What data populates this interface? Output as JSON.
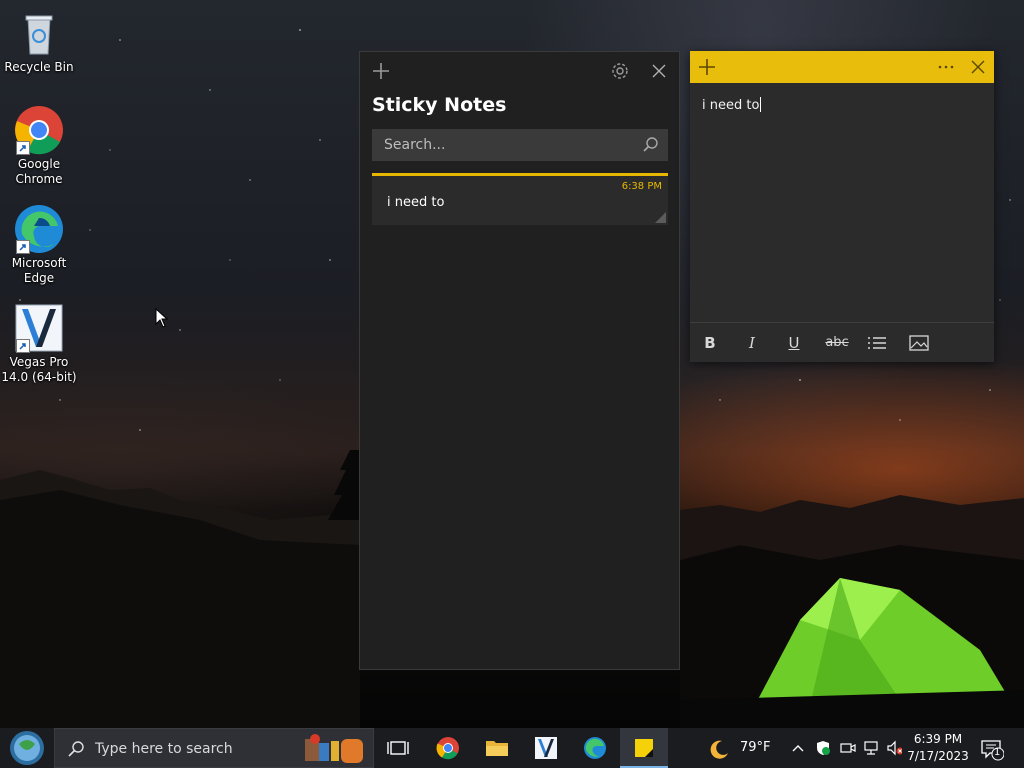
{
  "desktop": {
    "icons": [
      {
        "label": "Recycle Bin",
        "icon": "recycle-bin-icon"
      },
      {
        "label": "Google Chrome",
        "icon": "chrome-icon"
      },
      {
        "label": "Microsoft Edge",
        "icon": "edge-icon"
      },
      {
        "label": "Vegas Pro 14.0 (64-bit)",
        "icon": "vegas-pro-icon"
      }
    ]
  },
  "sticky_list": {
    "title": "Sticky Notes",
    "search_placeholder": "Search...",
    "notes": [
      {
        "time": "6:38 PM",
        "text": "i need to"
      }
    ]
  },
  "sticky_note": {
    "body": "i need to",
    "header_color": "#e8bd0b",
    "toolbar": [
      {
        "label": "B",
        "icon": "bold-icon"
      },
      {
        "label": "I",
        "icon": "italic-icon"
      },
      {
        "label": "U",
        "icon": "underline-icon"
      },
      {
        "label": "abc",
        "icon": "strikethrough-icon"
      },
      {
        "icon": "bullet-list-icon"
      },
      {
        "icon": "image-icon"
      }
    ]
  },
  "taskbar": {
    "search_placeholder": "Type here to search",
    "apps": [
      "task-view-icon",
      "chrome-icon",
      "file-explorer-icon",
      "vegas-pro-icon",
      "edge-icon",
      "sticky-notes-icon"
    ],
    "weather": {
      "temp": "79°F",
      "icon": "moon-icon"
    },
    "clock": {
      "time": "6:39 PM",
      "date": "7/17/2023"
    },
    "notifications_count": "1"
  }
}
